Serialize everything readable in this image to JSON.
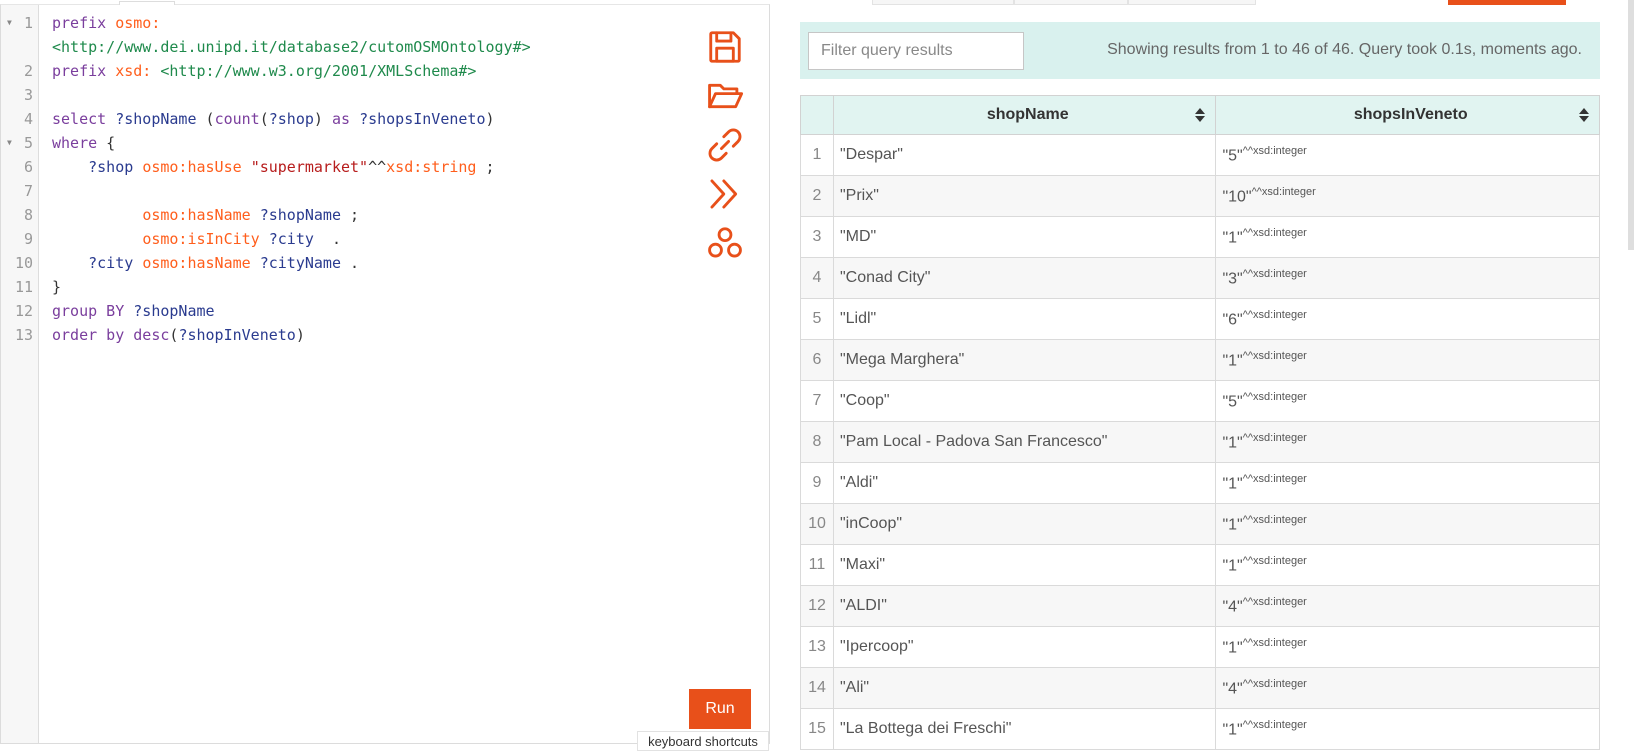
{
  "editor": {
    "lines": [
      {
        "n": "1",
        "fold": true,
        "html": "<span class='kw'>prefix</span> <span class='pfx'>osmo:</span>"
      },
      {
        "n": "",
        "fold": false,
        "html": "<span class='iri'>&lt;http://www.dei.unipd.it/database2/cutomOSMOntology#&gt;</span>"
      },
      {
        "n": "2",
        "fold": false,
        "html": "<span class='kw'>prefix</span> <span class='pfx'>xsd:</span> <span class='iri'>&lt;http://www.w3.org/2001/XMLSchema#&gt;</span>"
      },
      {
        "n": "3",
        "fold": false,
        "html": ""
      },
      {
        "n": "4",
        "fold": false,
        "html": "<span class='kw'>select</span> <span class='var'>?shopName</span> (<span class='kw'>count</span>(<span class='var'>?shop</span>) <span class='kw'>as</span> <span class='var'>?shopsInVeneto</span>)"
      },
      {
        "n": "5",
        "fold": true,
        "html": "<span class='kw'>where</span> {"
      },
      {
        "n": "6",
        "fold": false,
        "html": "    <span class='var'>?shop</span> <span class='pfx'>osmo:hasUse</span> <span class='str'>\"supermarket\"</span>^^<span class='pfx'>xsd:string</span> ;"
      },
      {
        "n": "7",
        "fold": false,
        "html": ""
      },
      {
        "n": "8",
        "fold": false,
        "html": "          <span class='pfx'>osmo:hasName</span> <span class='var'>?shopName</span> ;"
      },
      {
        "n": "9",
        "fold": false,
        "html": "          <span class='pfx'>osmo:isInCity</span> <span class='var'>?city</span>  ."
      },
      {
        "n": "10",
        "fold": false,
        "html": "    <span class='var'>?city</span> <span class='pfx'>osmo:hasName</span> <span class='var'>?cityName</span> ."
      },
      {
        "n": "11",
        "fold": false,
        "html": "}"
      },
      {
        "n": "12",
        "fold": false,
        "html": "<span class='kw'>group BY</span> <span class='var'>?shopName</span>"
      },
      {
        "n": "13",
        "fold": false,
        "html": "<span class='kw'>order by</span> <span class='kw'>desc</span>(<span class='var'>?shopInVeneto</span>)"
      }
    ],
    "run_label": "Run",
    "keyboard_shortcuts_label": "keyboard shortcuts"
  },
  "results": {
    "filter_placeholder": "Filter query results",
    "summary": "Showing results from 1 to 46 of 46. Query took 0.1s, moments ago.",
    "columns": [
      "shopName",
      "shopsInVeneto"
    ],
    "datatype": "^^xsd:integer",
    "rows": [
      {
        "idx": "1",
        "name": "\"Despar\"",
        "count": "\"5\""
      },
      {
        "idx": "2",
        "name": "\"Prix\"",
        "count": "\"10\""
      },
      {
        "idx": "3",
        "name": "\"MD\"",
        "count": "\"1\""
      },
      {
        "idx": "4",
        "name": "\"Conad City\"",
        "count": "\"3\""
      },
      {
        "idx": "5",
        "name": "\"Lidl\"",
        "count": "\"6\""
      },
      {
        "idx": "6",
        "name": "\"Mega Marghera\"",
        "count": "\"1\""
      },
      {
        "idx": "7",
        "name": "\"Coop\"",
        "count": "\"5\""
      },
      {
        "idx": "8",
        "name": "\"Pam Local - Padova San Francesco\"",
        "count": "\"1\""
      },
      {
        "idx": "9",
        "name": "\"Aldi\"",
        "count": "\"1\""
      },
      {
        "idx": "10",
        "name": "\"inCoop\"",
        "count": "\"1\""
      },
      {
        "idx": "11",
        "name": "\"Maxi\"",
        "count": "\"1\""
      },
      {
        "idx": "12",
        "name": "\"ALDI\"",
        "count": "\"4\""
      },
      {
        "idx": "13",
        "name": "\"Ipercoop\"",
        "count": "\"1\""
      },
      {
        "idx": "14",
        "name": "\"Ali\"",
        "count": "\"4\""
      },
      {
        "idx": "15",
        "name": "\"La Bottega dei Freschi\"",
        "count": "\"1\""
      }
    ]
  },
  "colors": {
    "accent": "#e8501a",
    "filter_bar_bg": "#d9f1ee",
    "header_bg": "#e1f4f1"
  },
  "icons": [
    "save-icon",
    "open-folder-icon",
    "link-icon",
    "double-chevron-right-icon",
    "share-network-icon"
  ]
}
